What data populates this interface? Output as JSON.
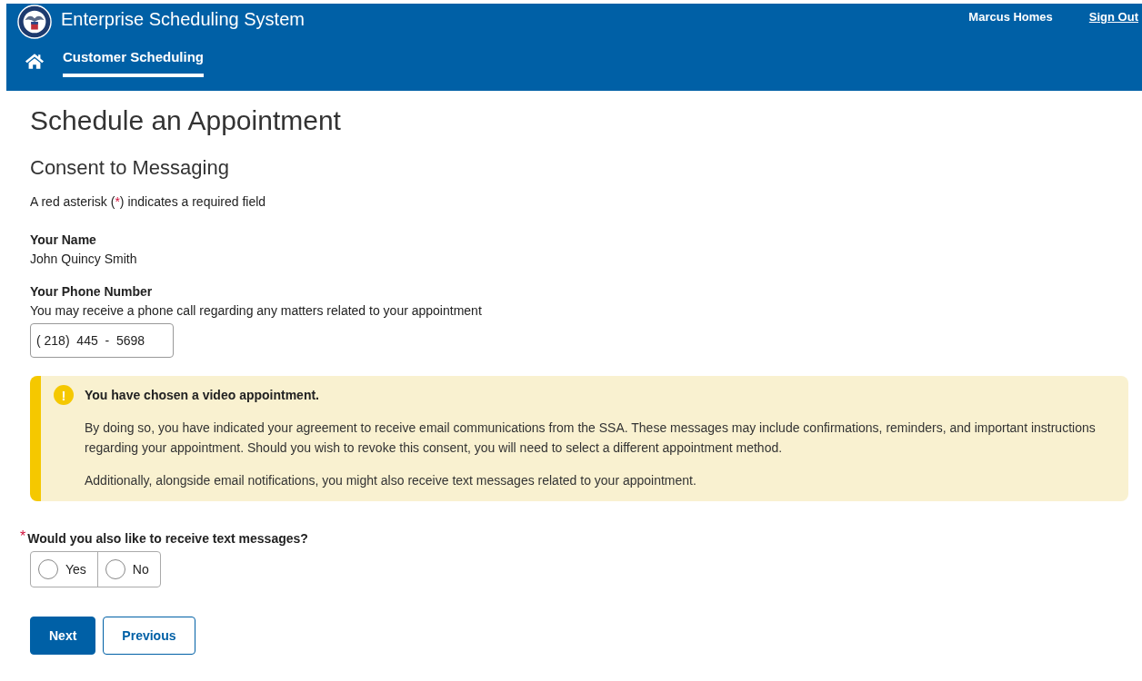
{
  "header": {
    "title": "Enterprise Scheduling System",
    "user": "Marcus Homes",
    "sign_out": "Sign Out",
    "nav": [
      {
        "label": "Customer Scheduling",
        "selected": true
      }
    ]
  },
  "page_title": "Schedule an Appointment",
  "section_title": "Consent to Messaging",
  "required_note": {
    "before": "A red asterisk (",
    "mark": "*",
    "after": ") indicates a required field"
  },
  "name": {
    "label": "Your Name",
    "value": "John Quincy Smith"
  },
  "phone": {
    "label": "Your Phone Number",
    "hint": "You may receive a phone call regarding any matters related to your appointment",
    "value": "( 218)  445  -  5698"
  },
  "alert": {
    "icon": "!",
    "title": "You have chosen a video appointment.",
    "paragraphs": [
      "By doing so, you have indicated your agreement to receive email communications from the SSA. These messages may include confirmations, reminders, and important instructions regarding your appointment. Should you wish to revoke this consent, you will need to select a different appointment method.",
      "Additionally, alongside email notifications, you might also receive text messages related to your appointment."
    ]
  },
  "question": {
    "required_mark": "*",
    "label": "Would you also like to receive text messages?",
    "options": [
      {
        "label": "Yes",
        "selected": false
      },
      {
        "label": "No",
        "selected": false
      }
    ]
  },
  "buttons": [
    {
      "label": "Next",
      "kind": "primary"
    },
    {
      "label": "Previous",
      "kind": "secondary"
    }
  ]
}
